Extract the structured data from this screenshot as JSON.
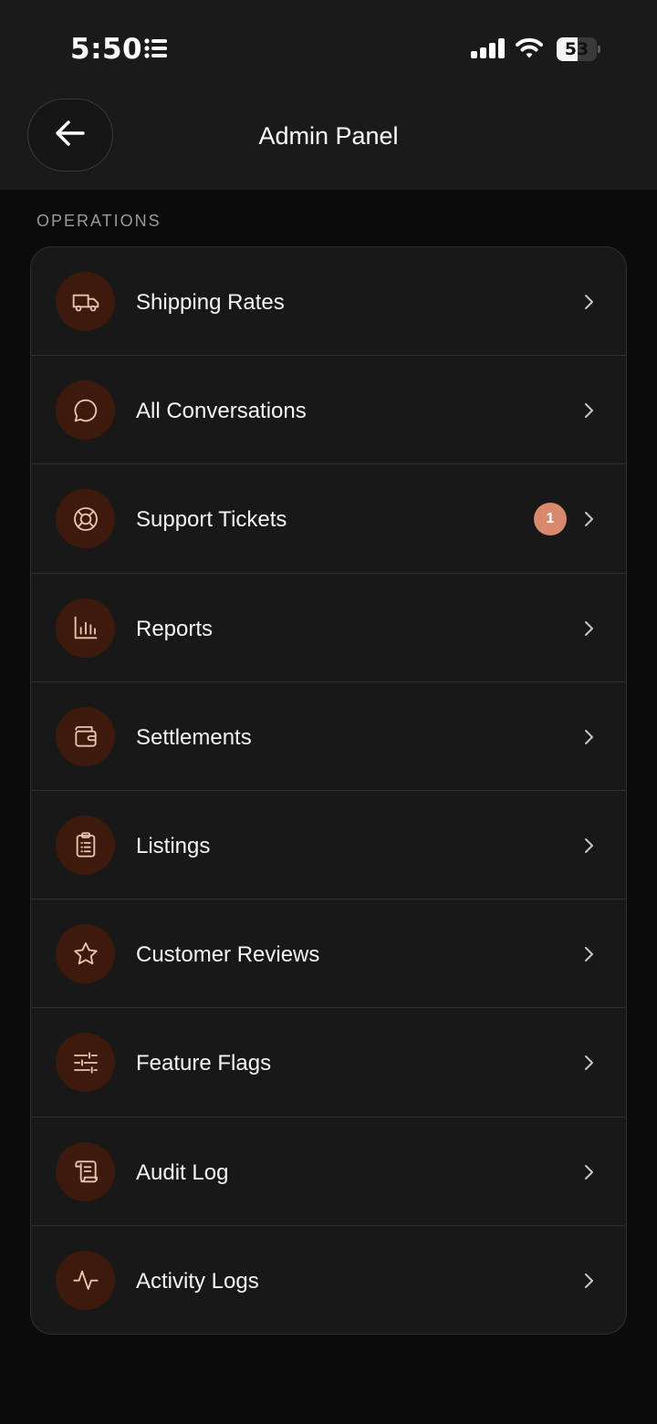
{
  "status_bar": {
    "time": "5:50",
    "battery_level": "53",
    "battery_fraction": 0.53
  },
  "header": {
    "title": "Admin Panel",
    "back_icon": "arrow-left-icon"
  },
  "section": {
    "label": "OPERATIONS"
  },
  "colors": {
    "accent": "#d98a6c",
    "icon_bg": "#3d1a0c",
    "icon_stroke": "#e9c3b4",
    "card_bg": "#181818"
  },
  "menu": {
    "items": [
      {
        "label": "Shipping Rates",
        "icon": "truck-icon"
      },
      {
        "label": "All Conversations",
        "icon": "chat-bubble-icon"
      },
      {
        "label": "Support Tickets",
        "icon": "lifebuoy-icon",
        "badge": "1"
      },
      {
        "label": "Reports",
        "icon": "bar-chart-icon"
      },
      {
        "label": "Settlements",
        "icon": "wallet-icon"
      },
      {
        "label": "Listings",
        "icon": "clipboard-list-icon"
      },
      {
        "label": "Customer Reviews",
        "icon": "star-icon"
      },
      {
        "label": "Feature Flags",
        "icon": "sliders-icon"
      },
      {
        "label": "Audit Log",
        "icon": "scroll-icon"
      },
      {
        "label": "Activity Logs",
        "icon": "activity-pulse-icon"
      }
    ]
  }
}
